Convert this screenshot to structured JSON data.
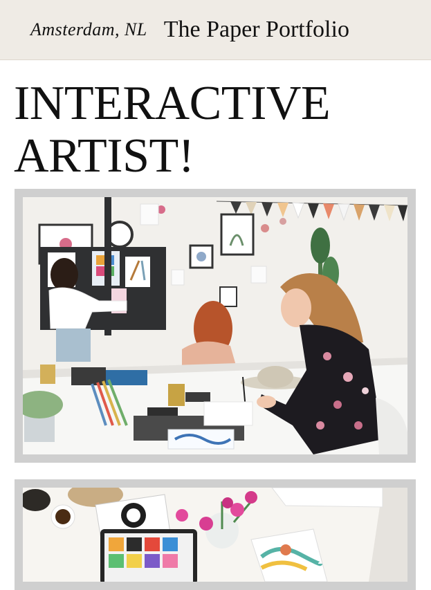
{
  "header": {
    "location": "Amsterdam, NL",
    "brand": "The Paper Portfolio"
  },
  "main": {
    "title": "INTERACTIVE ARTIST!"
  },
  "colors": {
    "header_bg": "#efebe5",
    "frame_bg": "#cfcfcf"
  }
}
